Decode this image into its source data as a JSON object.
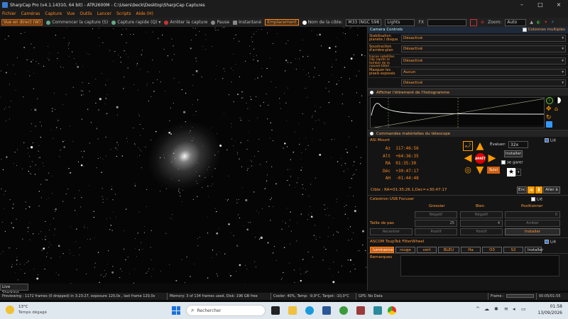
{
  "window": {
    "title": "SharpCap Pro (v4.1.14310, 64 bit) - ATR2600M - C:\\Users\\beck\\Desktop\\SharpCap Captures"
  },
  "menu": [
    "Fichier",
    "Caméras",
    "Capture",
    "Vue",
    "Outils",
    "Lancer",
    "Scripts",
    "Aide (H)"
  ],
  "toolbar": {
    "live_view": "Vue en direct (W)",
    "start_capture": "Commencer la capture (S)",
    "quick_capture": "Capture rapide (Q)",
    "stop_capture": "Arrêter la capture",
    "pause": "Pause",
    "snapshot": "Instantané",
    "placement": "Emplacement",
    "target_label": "Nom de la cible:",
    "target_value": "M33 (NGC 598",
    "filter_value": "Lights",
    "fx_label": "FX",
    "zoom_label": "Zoom:",
    "zoom_value": "Auto"
  },
  "live_stacking": "Live Stacking",
  "camera_controls": {
    "header": "Camera Controls",
    "multi_columns": "Colonnes multiples",
    "rows": [
      {
        "label": "Stabilisation planète / disque",
        "value": "Désactivé"
      },
      {
        "label": "Soustraction d'arrière-plan",
        "value": "Désactivé"
      },
      {
        "label": "Supprimer les traces satellites (Up (après le tomber de la nouvel-Idée)",
        "value": "Désactivé"
      },
      {
        "label": "Masquer les pixels exposés",
        "value": "Aucun"
      },
      {
        "label": "",
        "value": "Désactivé"
      }
    ]
  },
  "histogram": {
    "title": "Afficher l'étirement de l'histogramme"
  },
  "telescope": {
    "title": "Commandes matérielles du télescope",
    "mount_name": "ASI Mount",
    "linked": "Lié",
    "az_label": "Az",
    "az": "117:46:56",
    "alt_label": "Alt",
    "alt": "+64:36:35",
    "ra_label": "RA",
    "ra": "01:35:30",
    "dec_label": "Déc",
    "dec": "+30:47:17",
    "ah_label": "AH",
    "ah": "-01:44:48",
    "evaluate_label": "Évaluer:",
    "rate": "32x",
    "install": "Installer",
    "park": "se garer",
    "stop": "ARRÊT",
    "follow": "Suivi",
    "target": "Cible : RA=01:35:26.1,Dec=+30:47:17",
    "enc": "Enc",
    "stop_short": "Aller à"
  },
  "focuser": {
    "title": "Celestron USB Focuser",
    "linked": "Lié",
    "coarse": "Grossier",
    "fine": "Bien",
    "position": "Positionner",
    "negative1": "Négatif",
    "negative2": "Négatif",
    "position_value": "0",
    "step_label": "Taille de pas",
    "coarse_step": "25",
    "fine_step": "4",
    "stop": "Arrêter",
    "recenter": "Recentrer",
    "pos1": "Positif",
    "pos2": "Positif",
    "install": "Installer"
  },
  "filterwheel": {
    "title": "ASCOM ToupTek FilterWheel",
    "linked": "Lié",
    "filters": [
      "luminance",
      "rouge",
      "vert",
      "BLEU",
      "Ha",
      "O3",
      "S2"
    ],
    "install": "Installer"
  },
  "remarks": "Remarques",
  "status": {
    "previewing": "Previewing : 1172 frames (0 dropped) in 3:23:27, exposure 120,0s , last frame 120,0s",
    "memory": "Memory: 3 of 134 frames used, Disk: 196 GB free",
    "cooler": "Cooler: 40%, Temp: -9,9°C, Target: -10,0°C",
    "gps": "GPS: No Data",
    "frame_label": "Frame :",
    "time": "00:05/01:55"
  },
  "taskbar": {
    "temp": "13°C",
    "weather": "Temps dégagé",
    "search": "Rechercher",
    "clock": "01:58",
    "date": "13/09/2026"
  }
}
